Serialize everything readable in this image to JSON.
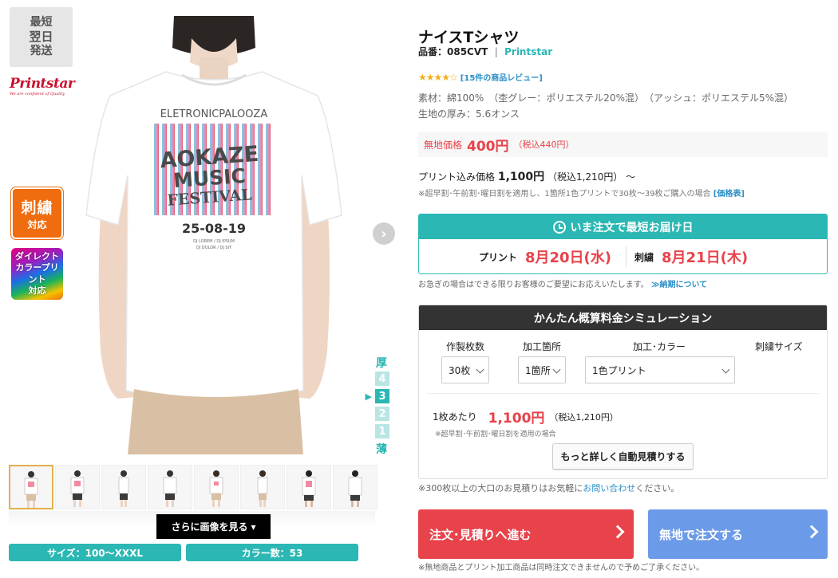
{
  "badge_fast": [
    "最短",
    "翌日",
    "発送"
  ],
  "brand_logo": {
    "word": "Printstar",
    "sub": "We are confident of Quality"
  },
  "feature_badges": {
    "embroidery": {
      "big": "刺繍",
      "small": "対応"
    },
    "direct_color": [
      "ダイレクト",
      "カラープリント",
      "対応"
    ]
  },
  "shirt_print": {
    "line1": "ELETRONICPALOOZA",
    "line2": "AOKAZE",
    "line3": "MUSIC",
    "line4": "FESTIVAL",
    "date": "25-08-19",
    "small1": "DJ LOREM / DJ IPSUM",
    "small2": "DJ DOLOR / DJ SIT"
  },
  "thickness": {
    "top": "厚",
    "bottom": "薄",
    "levels": [
      "4",
      "3",
      "2",
      "1"
    ],
    "current": "3",
    "pointer": "▶"
  },
  "gallery": {
    "thumbnail_count": 8,
    "active_index": 0,
    "more_button": "さらに画像を見る",
    "more_icon": "caret-down-icon"
  },
  "pills": {
    "size": "サイズ：100〜XXXL",
    "colors": "カラー数：53"
  },
  "product": {
    "title": "ナイスTシャツ",
    "code_label": "品番：085CVT",
    "divider": "|",
    "brand": "Printstar",
    "rating_stars": "★★★★☆",
    "rating_value": 4.5,
    "reviews": "[15件の商品レビュー]",
    "material": "素材：綿100%　（杢グレー：ポリエステル20%混）　（アッシュ：ポリエステル5%混）",
    "thickness": "生地の厚み：5.6オンス"
  },
  "price": {
    "label": "無地価格",
    "value": "400円",
    "tax": "（税込440円）"
  },
  "print_price": {
    "label": "プリント込み価格",
    "value": "1,100円",
    "tax": "（税込1,210円）",
    "suffix": "〜",
    "note": "※超早割･午前割･曜日割を適用し、1箇所1色プリントで30枚〜39枚ご購入の場合",
    "note_link": "[価格表]"
  },
  "delivery": {
    "heading": "いま注文で最短お届け日",
    "print_label": "プリント",
    "print_date": "8月20日(水)",
    "emb_label": "刺繍",
    "emb_date": "8月21日(木)",
    "urgent_note": "お急ぎの場合はできる限りお客様のご要望にお応えいたします。",
    "urgent_link": "≫納期について"
  },
  "simulation": {
    "heading": "かんたん概算料金シミュレーション",
    "labels": {
      "qty": "作製枚数",
      "place": "加工箇所",
      "color": "加工･カラー",
      "emb": "刺繍サイズ"
    },
    "values": {
      "qty": "30枚",
      "place": "1箇所",
      "color": "1色プリント"
    },
    "per_label": "1枚あたり",
    "per_value": "1,100円",
    "per_tax": "（税込1,210円）",
    "note": "※超早割･午前割･曜日割を適用の場合",
    "detail_button": "もっと詳しく自動見積りする"
  },
  "bulk_note": {
    "before": "※300枚以上の大口のお見積りはお気軽に",
    "link": "お問い合わせ",
    "after": "ください。"
  },
  "cta": {
    "order": "注文･見積りへ進む",
    "plain": "無地で注文する"
  },
  "footer_note": "※無地商品とプリント加工商品は同時注文できませんので予めご了承ください。",
  "colors": {
    "accent": "#2bb7b3",
    "price_red": "#e8424a",
    "cta_blue": "#6b9ae8",
    "dark_header": "#333333"
  }
}
